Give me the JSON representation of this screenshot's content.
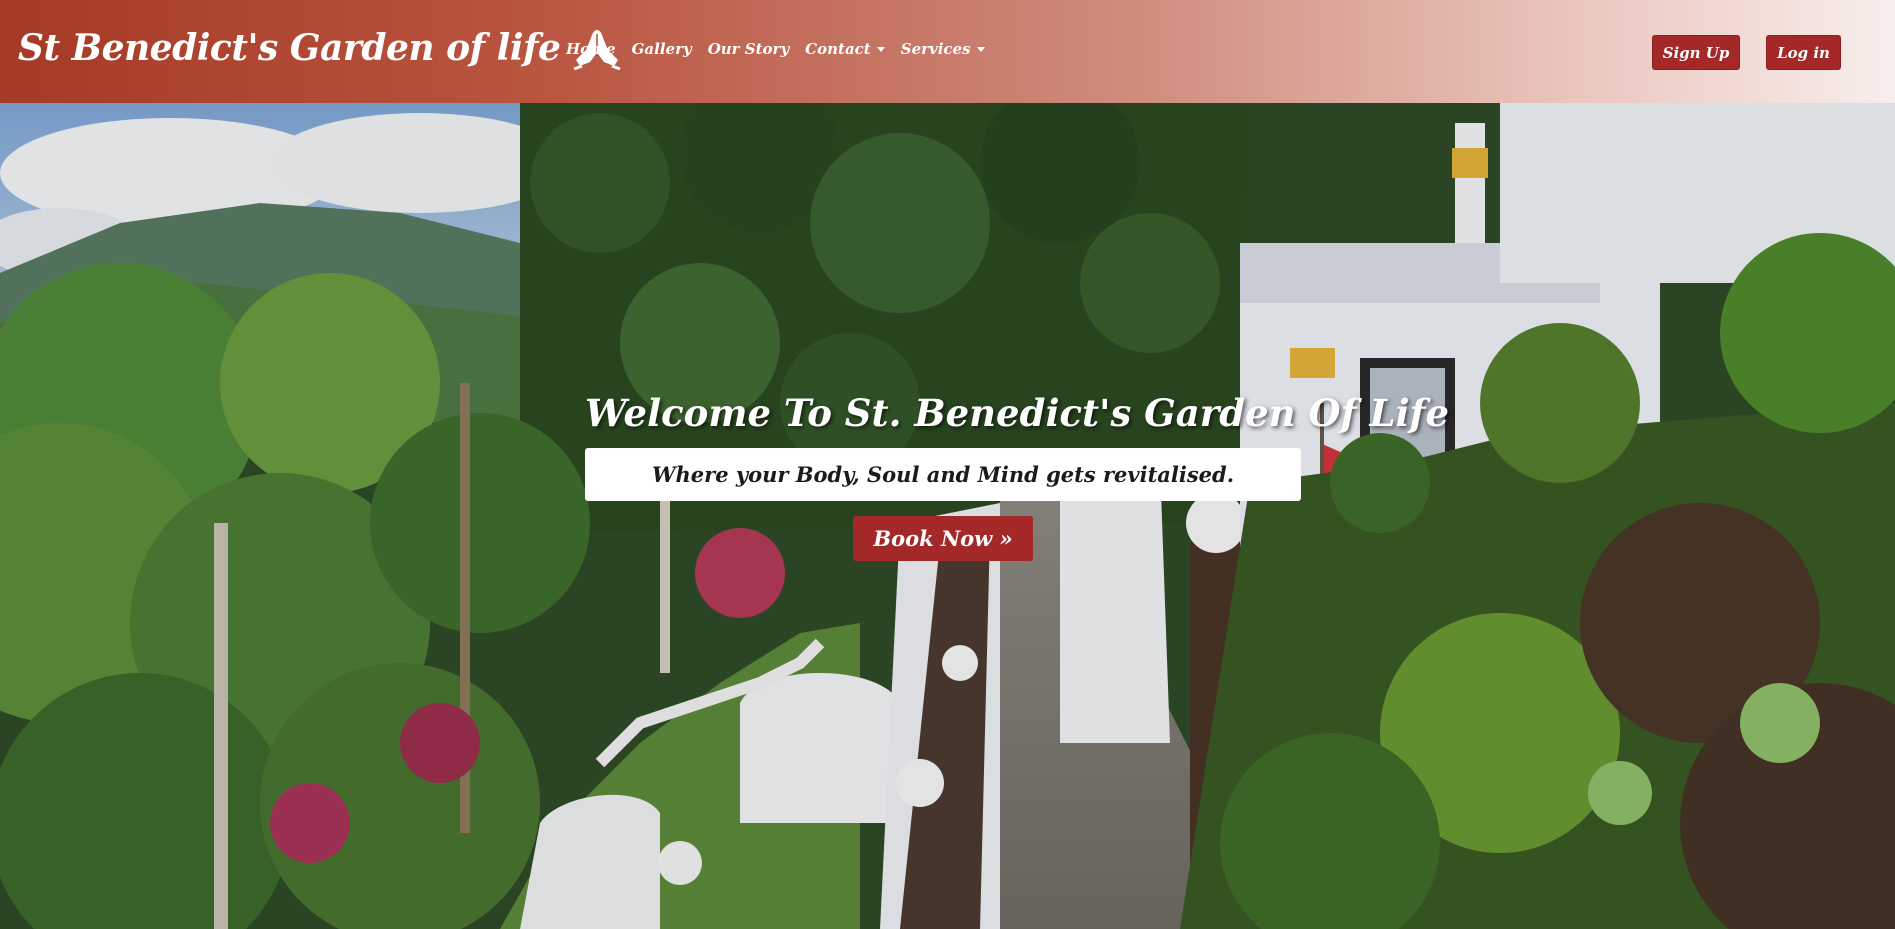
{
  "brand": {
    "title": "St Benedict's Garden of life",
    "icon": "praying-hands-icon"
  },
  "nav": {
    "items": [
      {
        "label": "Home"
      },
      {
        "label": "Gallery"
      },
      {
        "label": "Our Story"
      },
      {
        "label": "Contact",
        "dropdown": true
      },
      {
        "label": "Services",
        "dropdown": true
      }
    ],
    "signup_label": "Sign Up",
    "login_label": "Log in"
  },
  "hero": {
    "title": "Welcome To St. Benedict's Garden Of Life",
    "subtitle": "Where your Body, Soul and Mind gets revitalised.",
    "cta_label": "Book Now »",
    "background": "tropical-garden-photo"
  },
  "colors": {
    "accent": "#a52829",
    "nav_gradient_start": "#a53a26",
    "nav_gradient_end": "#f8eeec"
  }
}
